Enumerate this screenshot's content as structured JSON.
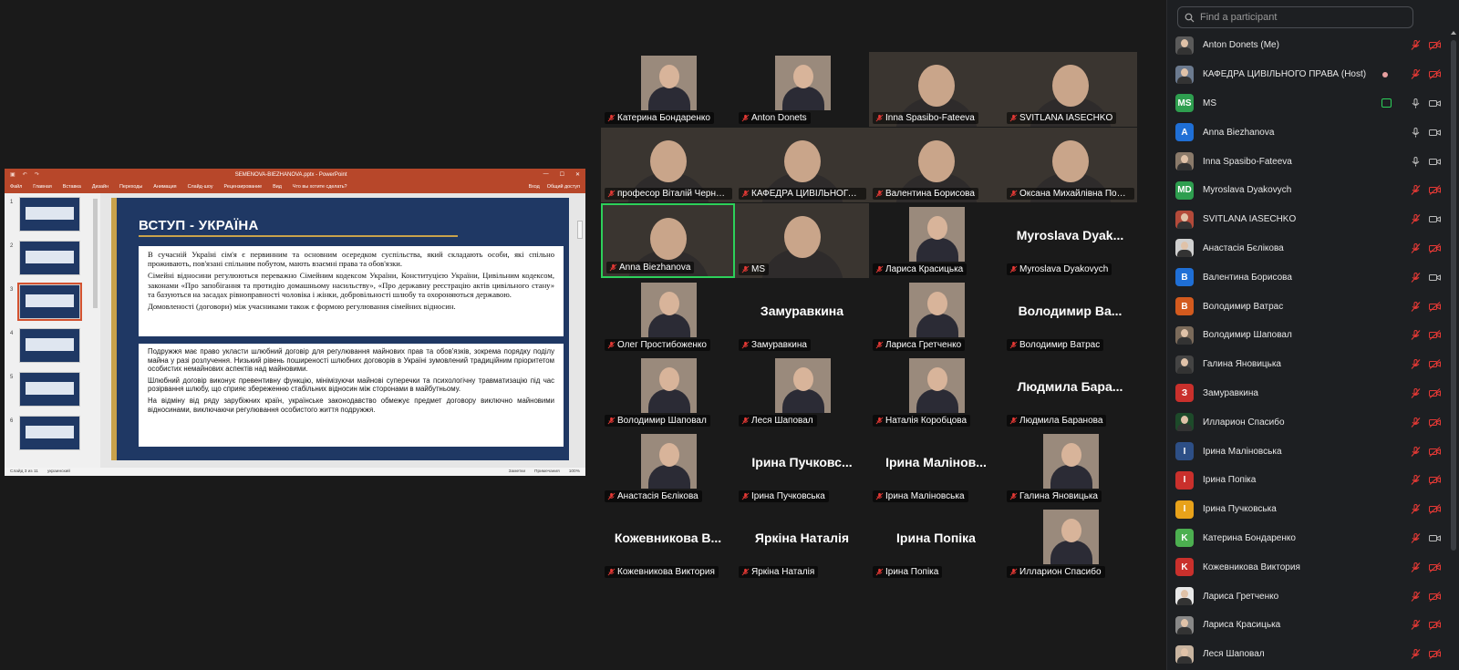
{
  "ppt": {
    "title": "SEMENOVA-BIEZHANOVA.pptx - PowerPoint",
    "ribbon": [
      "Файл",
      "Главная",
      "Вставка",
      "Дизайн",
      "Переходы",
      "Анимация",
      "Слайд-шоу",
      "Рецензирование",
      "Вид",
      "Что вы хотите сделать?"
    ],
    "ribbon_right": [
      "Вход",
      "Общий доступ"
    ],
    "slide_numbers": [
      "1",
      "2",
      "3",
      "4",
      "5",
      "6"
    ],
    "selected_slide": 3,
    "slide": {
      "heading": "ВСТУП - УКРАЇНА",
      "box1": [
        "В сучасній Україні сім'я є первинним та основним осередком суспільства, який складають особи, які спільно проживають, пов'язані спільним побутом, мають взаємні права та обов'язки.",
        "Сімейні відносини регулюються переважно Сімейним кодексом України, Конституцією України, Цивільним кодексом, законами «Про запобігання та протидію домашньому насильству», «Про державну реєстрацію актів цивільного стану» та базуються на засадах рівноправності чоловіка і жінки, добровільності шлюбу та охороняються державою.",
        "Домовленості (договори) між учасниками також є формою регулювання сімейних відносин."
      ],
      "box2": [
        "Подружжя має право укласти шлюбний договір для регулювання майнових прав та обов'язків, зокрема порядку поділу майна у разі розлучення. Низький рівень поширеності шлюбних договорів в Україні зумовлений традиційним пріоритетом особистих немайнових аспектів над майновими.",
        "Шлюбний договір виконує превентивну функцію, мінімізуючи майнові суперечки та психологічну травматизацію під час розірвання шлюбу, що сприяє збереженню стабільних відносин між сторонами в майбутньому.",
        "На відміну від ряду зарубіжних країн, українське законодавство обмежує предмет договору виключно майновими відносинами, виключаючи регулювання особистого життя подружжя."
      ]
    },
    "status_left": [
      "Слайд 3 из 11",
      "украинский"
    ],
    "status_right": [
      "Заметки",
      "Примечания",
      "100%"
    ]
  },
  "grid": [
    {
      "name": "Катерина Бондаренко",
      "kind": "avatar"
    },
    {
      "name": "Anton Donets",
      "kind": "avatar"
    },
    {
      "name": "Inna Spasibo-Fateeva",
      "kind": "video"
    },
    {
      "name": "SVITLANA IASECHKO",
      "kind": "video"
    },
    {
      "name": "професор Віталій Чернега",
      "kind": "video"
    },
    {
      "name": "КАФЕДРА ЦИВІЛЬНОГО ПР...",
      "kind": "video"
    },
    {
      "name": "Валентина Борисова",
      "kind": "video"
    },
    {
      "name": "Оксана Михайлівна Пономар...",
      "kind": "video"
    },
    {
      "name": "Anna Biezhanova",
      "kind": "video",
      "active": true
    },
    {
      "name": "MS",
      "kind": "video"
    },
    {
      "name": "Лариса Красицька",
      "kind": "avatar"
    },
    {
      "name": "Myroslava Dyakovych",
      "kind": "text",
      "big": "Myroslava Dyak..."
    },
    {
      "name": "Олег Простибоженко",
      "kind": "avatar"
    },
    {
      "name": "Замуравкина",
      "kind": "text",
      "big": "Замуравкина"
    },
    {
      "name": "Лариса Гретченко",
      "kind": "avatar"
    },
    {
      "name": "Володимир Ватрас",
      "kind": "text",
      "big": "Володимир Ва..."
    },
    {
      "name": "Володимир Шаповал",
      "kind": "avatar"
    },
    {
      "name": "Леся Шаповал",
      "kind": "avatar"
    },
    {
      "name": "Наталія Коробцова",
      "kind": "avatar"
    },
    {
      "name": "Людмила Баранова",
      "kind": "text",
      "big": "Людмила Бара..."
    },
    {
      "name": "Анастасія Бєлікова",
      "kind": "avatar"
    },
    {
      "name": "Ірина Пучковська",
      "kind": "text",
      "big": "Ірина Пучковс..."
    },
    {
      "name": "Ірина Маліновська",
      "kind": "text",
      "big": "Ірина Малінов..."
    },
    {
      "name": "Галина Яновицька",
      "kind": "avatar"
    },
    {
      "name": "Кожевникова Виктория",
      "kind": "text",
      "big": "Кожевникова В..."
    },
    {
      "name": "Яркіна Наталія",
      "kind": "text",
      "big": "Яркіна Наталія"
    },
    {
      "name": "Ірина Попіка",
      "kind": "text",
      "big": "Ірина Попіка"
    },
    {
      "name": "Илларион Спасибо",
      "kind": "avatar"
    }
  ],
  "panel": {
    "search_placeholder": "Find a participant",
    "participants": [
      {
        "name": "Anton Donets (Me)",
        "av": "photo",
        "color": "#5a5a5a",
        "mic": "muted",
        "cam": "off"
      },
      {
        "name": "КАФЕДРА ЦИВІЛЬНОГО ПРАВА (Host)",
        "av": "photo",
        "color": "#6b7a8f",
        "mic": "muted",
        "cam": "off",
        "rec": true
      },
      {
        "name": "MS",
        "av": "MS",
        "color": "#2e9e4f",
        "mic": "on",
        "cam": "on",
        "share": true
      },
      {
        "name": "Anna Biezhanova",
        "av": "A",
        "color": "#1f6fd6",
        "mic": "on",
        "cam": "on"
      },
      {
        "name": "Inna Spasibo-Fateeva",
        "av": "photo",
        "color": "#8a7a6a",
        "mic": "on",
        "cam": "on"
      },
      {
        "name": "Myroslava Dyakovych",
        "av": "MD",
        "color": "#2e9e4f",
        "mic": "muted",
        "cam": "off"
      },
      {
        "name": "SVITLANA IASECHKO",
        "av": "photo",
        "color": "#b34a3a",
        "mic": "muted",
        "cam": "on"
      },
      {
        "name": "Анастасія Бєлікова",
        "av": "photo",
        "color": "#d0d0d0",
        "mic": "muted",
        "cam": "off"
      },
      {
        "name": "Валентина Борисова",
        "av": "B",
        "color": "#1f6fd6",
        "mic": "muted",
        "cam": "on"
      },
      {
        "name": "Володимир Ватрас",
        "av": "B",
        "color": "#d35a1e",
        "mic": "muted",
        "cam": "off"
      },
      {
        "name": "Володимир Шаповал",
        "av": "photo",
        "color": "#7a6a5a",
        "mic": "muted",
        "cam": "off"
      },
      {
        "name": "Галина Яновицька",
        "av": "photo",
        "color": "#444",
        "mic": "muted",
        "cam": "off"
      },
      {
        "name": "Замуравкина",
        "av": "З",
        "color": "#c9302c",
        "mic": "muted",
        "cam": "off"
      },
      {
        "name": "Илларион Спасибо",
        "av": "photo",
        "color": "#1d4a2a",
        "mic": "muted",
        "cam": "off"
      },
      {
        "name": "Ірина Маліновська",
        "av": "I",
        "color": "#2d4f86",
        "mic": "muted",
        "cam": "off"
      },
      {
        "name": "Ірина Попіка",
        "av": "I",
        "color": "#c9302c",
        "mic": "muted",
        "cam": "off"
      },
      {
        "name": "Ірина Пучковська",
        "av": "I",
        "color": "#e8a21a",
        "mic": "muted",
        "cam": "off"
      },
      {
        "name": "Катерина Бондаренко",
        "av": "K",
        "color": "#4caf50",
        "mic": "muted",
        "cam": "on"
      },
      {
        "name": "Кожевникова Виктория",
        "av": "K",
        "color": "#c9302c",
        "mic": "muted",
        "cam": "off"
      },
      {
        "name": "Лариса Гретченко",
        "av": "photo",
        "color": "#e8e8e8",
        "mic": "muted",
        "cam": "off"
      },
      {
        "name": "Лариса Красицька",
        "av": "photo",
        "color": "#888",
        "mic": "muted",
        "cam": "off"
      },
      {
        "name": "Леся Шаповал",
        "av": "photo",
        "color": "#c8b4a0",
        "mic": "muted",
        "cam": "off"
      }
    ]
  }
}
